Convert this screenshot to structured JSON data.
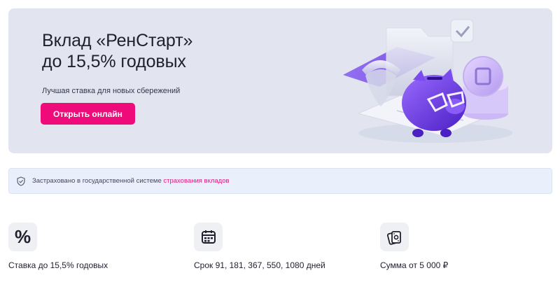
{
  "hero": {
    "title_line1": "Вклад «РенСтарт»",
    "title_line2": "до 15,5% годовых",
    "subtitle": "Лучшая ставка для новых сбережений",
    "button_label": "Открыть онлайн"
  },
  "notice": {
    "text": "Застраховано в государственной системе ",
    "link_label": "страхования вкладов"
  },
  "features": [
    {
      "icon": "percent-icon",
      "label": "Ставка до 15,5% годовых",
      "glyph": "%"
    },
    {
      "icon": "calendar-icon",
      "label": "Срок 91, 181, 367, 550, 1080 дней"
    },
    {
      "icon": "banknotes-icon",
      "label": "Сумма от 5 000 ₽"
    }
  ],
  "colors": {
    "accent": "#ef0b7a",
    "hero_bg": "#e2e5ef",
    "notice_bg": "#eaf0fb",
    "link": "#e3167f"
  }
}
